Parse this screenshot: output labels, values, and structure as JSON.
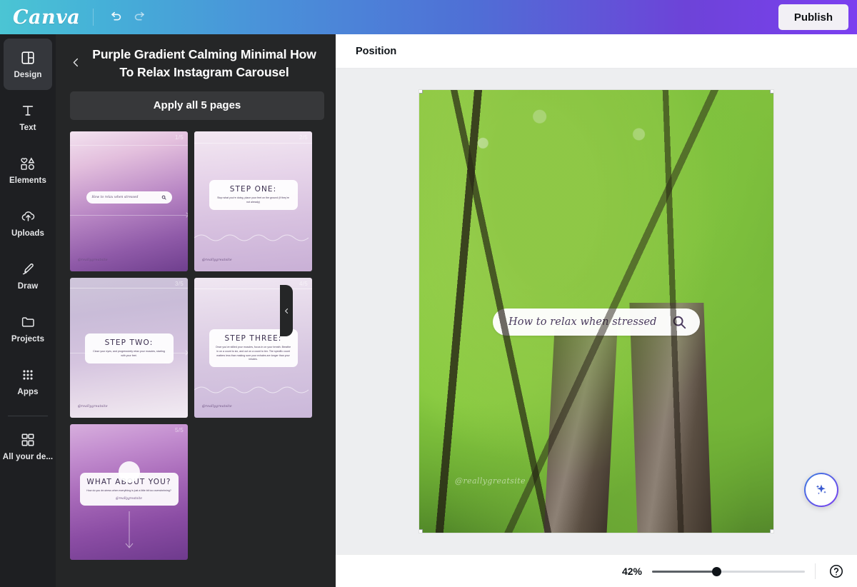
{
  "topbar": {
    "logo": "Canva",
    "undo_icon": "undo-icon",
    "redo_icon": "redo-icon",
    "publish_label": "Publish"
  },
  "rail": {
    "items": [
      {
        "label": "Design",
        "icon": "design-icon",
        "active": true
      },
      {
        "label": "Text",
        "icon": "text-icon",
        "active": false
      },
      {
        "label": "Elements",
        "icon": "elements-icon",
        "active": false
      },
      {
        "label": "Uploads",
        "icon": "uploads-icon",
        "active": false
      },
      {
        "label": "Draw",
        "icon": "draw-icon",
        "active": false
      },
      {
        "label": "Projects",
        "icon": "projects-icon",
        "active": false
      },
      {
        "label": "Apps",
        "icon": "apps-icon",
        "active": false
      }
    ],
    "footer_item": {
      "label": "All your de...",
      "icon": "all-designs-icon"
    }
  },
  "panel": {
    "back_icon": "chevron-left-icon",
    "title": "Purple Gradient Calming Minimal How To Relax Instagram Carousel",
    "apply_label": "Apply all 5 pages",
    "collapse_icon": "chevron-left-icon",
    "thumbnails": [
      {
        "page_badge": "1/5",
        "kind": "search",
        "search_text": "How to relax when stressed",
        "search_icon": "search-icon",
        "handle": "@reallygreatsite"
      },
      {
        "page_badge": "2/5",
        "kind": "step",
        "heading": "STEP ONE:",
        "body": "Stop what you're doing, place your feet on the ground (if they're not already)",
        "handle": "@reallygreatsite"
      },
      {
        "page_badge": "3/5",
        "kind": "step",
        "heading": "STEP TWO:",
        "body": "Close your eyes, and progressively relax your muscles, starting with your feet.",
        "handle": "@reallygreatsite"
      },
      {
        "page_badge": "4/5",
        "kind": "step",
        "heading": "STEP THREE:",
        "body": "Once you've stilled your muscles, focus in on your breath. Breathe in on a count to six, and out on a count to ten. The specific count matters less than making sure your exhales are longer than your inhales.",
        "handle": "@reallygreatsite"
      },
      {
        "page_badge": "5/5",
        "kind": "question",
        "heading": "WHAT ABOUT YOU?",
        "body": "How do you de-stress when everything is just a little bit too overwhelming?",
        "handle": "@reallygreatsite"
      }
    ]
  },
  "toolbar": {
    "position_label": "Position"
  },
  "canvas": {
    "search_text": "How to relax when stressed",
    "search_icon": "search-icon",
    "watermark": "@reallygreatsite",
    "magic_icon": "magic-sparkle-icon"
  },
  "bottombar": {
    "zoom_percent": "42%",
    "slider_icon": "zoom-slider",
    "help_icon": "help-icon"
  },
  "colors": {
    "brand_purple": "#7b3ff0",
    "brand_teal": "#4bc5d4",
    "panel_bg": "#252627",
    "rail_bg": "#1e1f22",
    "stage_bg": "#edeef0"
  }
}
